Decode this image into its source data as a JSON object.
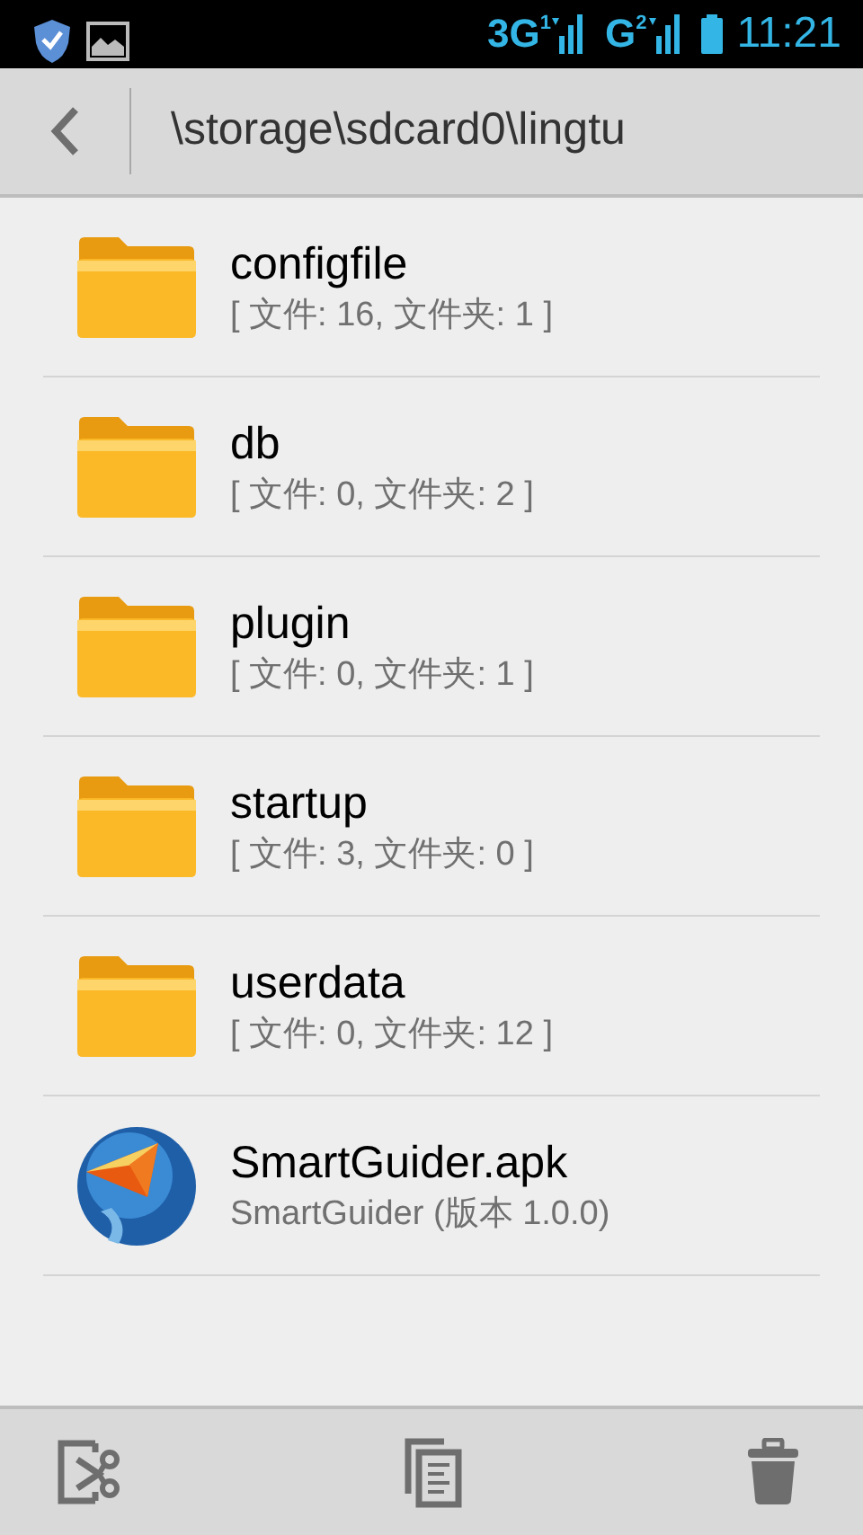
{
  "status_bar": {
    "networks": [
      {
        "type": "3G",
        "sim": "1"
      },
      {
        "type": "G",
        "sim": "2"
      }
    ],
    "time": "11:21"
  },
  "header": {
    "path": "\\storage\\sdcard0\\lingtu"
  },
  "items": [
    {
      "kind": "folder",
      "name": "configfile",
      "detail": "[ 文件: 16, 文件夹: 1 ]"
    },
    {
      "kind": "folder",
      "name": "db",
      "detail": "[ 文件: 0, 文件夹: 2 ]"
    },
    {
      "kind": "folder",
      "name": "plugin",
      "detail": "[ 文件: 0, 文件夹: 1 ]"
    },
    {
      "kind": "folder",
      "name": "startup",
      "detail": "[ 文件: 3, 文件夹: 0 ]"
    },
    {
      "kind": "folder",
      "name": "userdata",
      "detail": "[ 文件: 0, 文件夹: 12 ]"
    },
    {
      "kind": "apk",
      "name": "SmartGuider.apk",
      "detail": "SmartGuider (版本 1.0.0)"
    }
  ]
}
